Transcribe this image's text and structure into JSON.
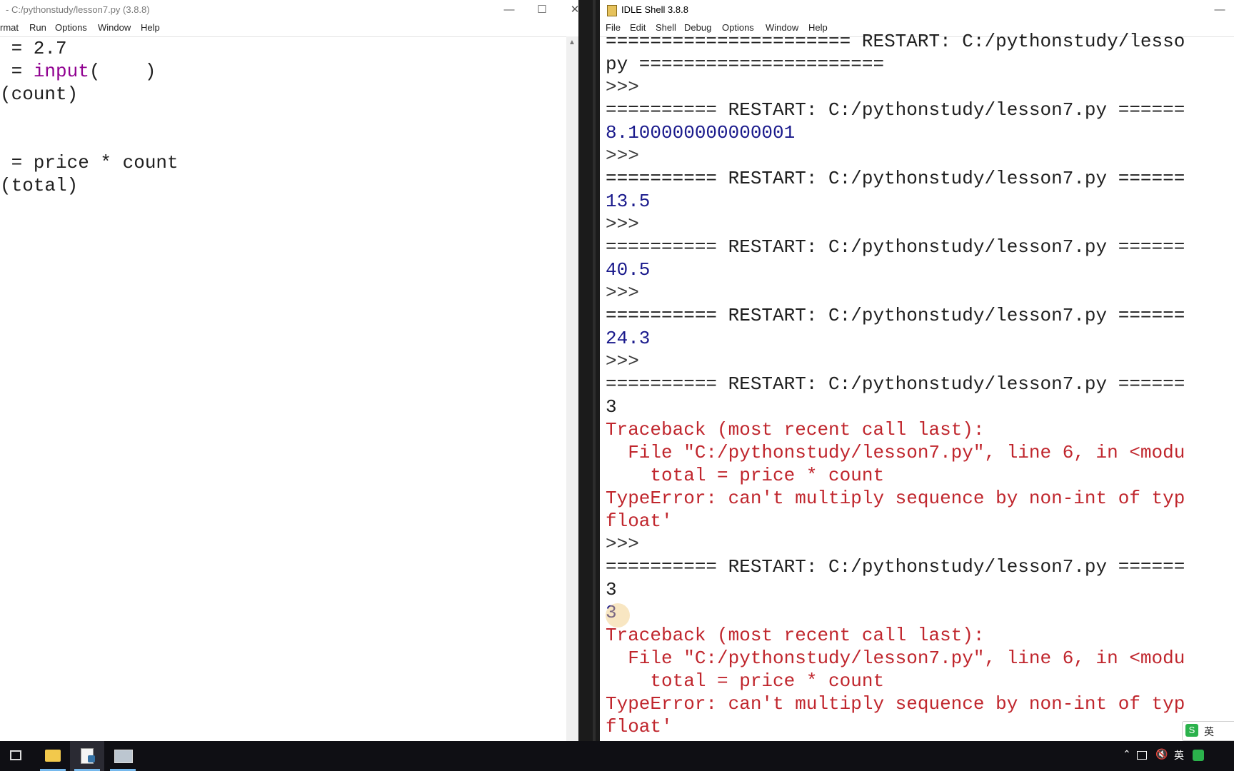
{
  "editor": {
    "title": "- C:/pythonstudy/lesson7.py (3.8.8)",
    "menu": [
      "rmat",
      "Run",
      "Options",
      "Window",
      "Help"
    ],
    "lines": [
      {
        "segments": [
          {
            "t": " = 2.7",
            "c": "norm"
          }
        ]
      },
      {
        "segments": [
          {
            "t": " = ",
            "c": "norm"
          },
          {
            "t": "input",
            "c": "kw-builtin"
          },
          {
            "t": "(    )",
            "c": "norm"
          }
        ]
      },
      {
        "segments": [
          {
            "t": "(count)",
            "c": "norm"
          }
        ]
      },
      {
        "segments": [
          {
            "t": "",
            "c": "norm"
          }
        ]
      },
      {
        "segments": [
          {
            "t": "",
            "c": "norm"
          }
        ]
      },
      {
        "segments": [
          {
            "t": " = price * count",
            "c": "norm"
          }
        ]
      },
      {
        "segments": [
          {
            "t": "(total)",
            "c": "norm"
          }
        ]
      }
    ]
  },
  "shell": {
    "title": "IDLE Shell 3.8.8",
    "menu": [
      "File",
      "Edit",
      "Shell",
      "Debug",
      "Options",
      "Window",
      "Help"
    ],
    "lines": [
      {
        "t": "====================== RESTART: C:/pythonstudy/lesso",
        "c": "norm"
      },
      {
        "t": "py ======================",
        "c": "norm"
      },
      {
        "t": ">>>",
        "c": "prompt"
      },
      {
        "t": "========== RESTART: C:/pythonstudy/lesson7.py ======",
        "c": "norm"
      },
      {
        "t": "8.100000000000001",
        "c": "out"
      },
      {
        "t": ">>>",
        "c": "prompt"
      },
      {
        "t": "========== RESTART: C:/pythonstudy/lesson7.py ======",
        "c": "norm"
      },
      {
        "t": "13.5",
        "c": "out"
      },
      {
        "t": ">>>",
        "c": "prompt"
      },
      {
        "t": "========== RESTART: C:/pythonstudy/lesson7.py ======",
        "c": "norm"
      },
      {
        "t": "40.5",
        "c": "out"
      },
      {
        "t": ">>>",
        "c": "prompt"
      },
      {
        "t": "========== RESTART: C:/pythonstudy/lesson7.py ======",
        "c": "norm"
      },
      {
        "t": "24.3",
        "c": "out"
      },
      {
        "t": ">>>",
        "c": "prompt"
      },
      {
        "t": "========== RESTART: C:/pythonstudy/lesson7.py ======",
        "c": "norm"
      },
      {
        "t": "3",
        "c": "norm"
      },
      {
        "t": "Traceback (most recent call last):",
        "c": "err"
      },
      {
        "t": "  File \"C:/pythonstudy/lesson7.py\", line 6, in <modu",
        "c": "err"
      },
      {
        "t": "    total = price * count",
        "c": "err"
      },
      {
        "t": "TypeError: can't multiply sequence by non-int of typ",
        "c": "err"
      },
      {
        "t": "float'",
        "c": "err"
      },
      {
        "t": ">>>",
        "c": "prompt"
      },
      {
        "t": "========== RESTART: C:/pythonstudy/lesson7.py ======",
        "c": "norm"
      },
      {
        "t": "3",
        "c": "norm"
      },
      {
        "t": "3",
        "c": "out"
      },
      {
        "t": "Traceback (most recent call last):",
        "c": "err"
      },
      {
        "t": "  File \"C:/pythonstudy/lesson7.py\", line 6, in <modu",
        "c": "err"
      },
      {
        "t": "    total = price * count",
        "c": "err"
      },
      {
        "t": "TypeError: can't multiply sequence by non-int of typ",
        "c": "err"
      },
      {
        "t": "float'",
        "c": "err"
      },
      {
        "t": ">>> |",
        "c": "prompt"
      }
    ]
  },
  "taskbar": {
    "tray": {
      "ime": "英",
      "ime_badge": "英"
    }
  },
  "colors": {
    "builtin": "#900090",
    "output": "#1a1a8c",
    "error": "#c0262d",
    "taskbar": "#0f0f14"
  }
}
